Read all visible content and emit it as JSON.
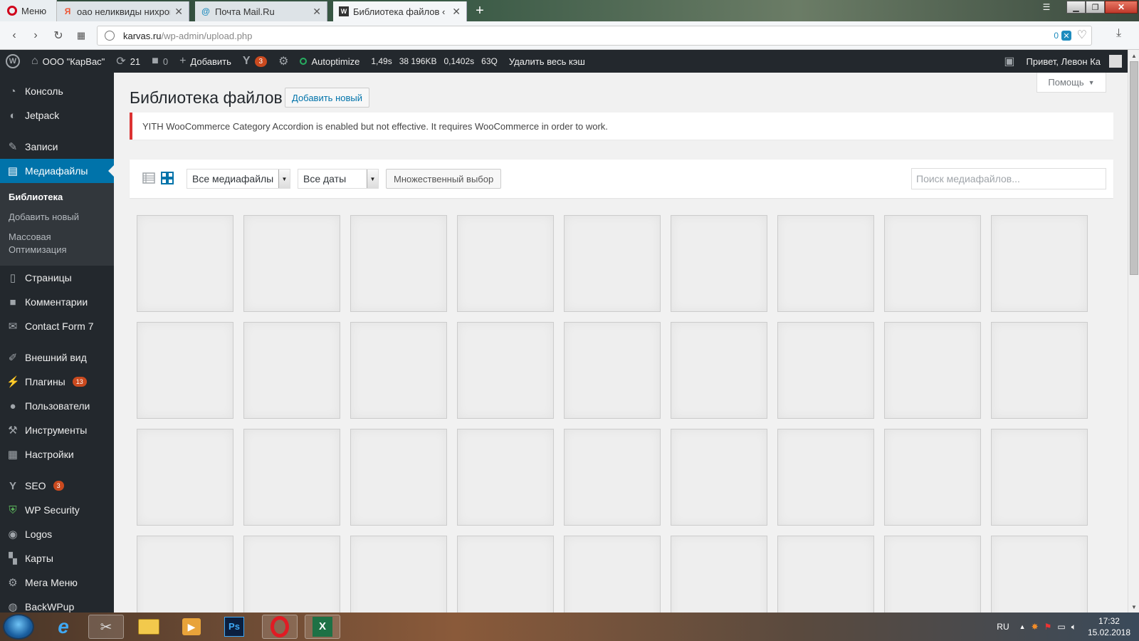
{
  "browser": {
    "menu_label": "Меню",
    "tabs": [
      {
        "title": "оао неликвиды нихром –",
        "favicon": "yandex-icon"
      },
      {
        "title": "Почта Mail.Ru",
        "favicon": "mailru-icon"
      },
      {
        "title": "Библиотека файлов ‹ ООО",
        "favicon": "wordpress-icon"
      }
    ],
    "url_host": "karvas.ru",
    "url_path": "/wp-admin/upload.php",
    "adblock_count": "0"
  },
  "adminbar": {
    "site_name": "ООО \"КарВас\"",
    "updates_count": "21",
    "comments_count": "0",
    "add_label": "Добавить",
    "yoast_badge": "3",
    "autoptimize_label": "Autoptimize",
    "stats": [
      "1,49s",
      "38 196KB",
      "0,1402s",
      "63Q"
    ],
    "clear_cache_label": "Удалить весь кэш",
    "greeting": "Привет, Левон Ка"
  },
  "sidebar": {
    "items": [
      {
        "label": "Консоль",
        "icon": "dashboard-icon"
      },
      {
        "label": "Jetpack",
        "icon": "jetpack-icon"
      },
      {
        "label": "Записи",
        "icon": "pin-icon"
      },
      {
        "label": "Медиафайлы",
        "icon": "media-icon"
      },
      {
        "label": "Страницы",
        "icon": "page-icon"
      },
      {
        "label": "Комментарии",
        "icon": "comment-icon"
      },
      {
        "label": "Contact Form 7",
        "icon": "mail-icon"
      },
      {
        "label": "Внешний вид",
        "icon": "brush-icon"
      },
      {
        "label": "Плагины",
        "icon": "plugin-icon",
        "badge": "13"
      },
      {
        "label": "Пользователи",
        "icon": "user-icon"
      },
      {
        "label": "Инструменты",
        "icon": "wrench-icon"
      },
      {
        "label": "Настройки",
        "icon": "settings-icon"
      },
      {
        "label": "SEO",
        "icon": "yoast-icon",
        "badge": "3"
      },
      {
        "label": "WP Security",
        "icon": "shield-icon"
      },
      {
        "label": "Logos",
        "icon": "logos-icon"
      },
      {
        "label": "Карты",
        "icon": "map-icon"
      },
      {
        "label": "Мега Меню",
        "icon": "megamenu-icon"
      },
      {
        "label": "BackWPup",
        "icon": "backup-icon"
      }
    ],
    "submenu": [
      {
        "label": "Библиотека",
        "current": true
      },
      {
        "label": "Добавить новый"
      },
      {
        "label": "Массовая Оптимизация"
      }
    ]
  },
  "main": {
    "help_label": "Помощь",
    "title": "Библиотека файлов",
    "add_new_label": "Добавить новый",
    "notice_text": "YITH WooCommerce Category Accordion is enabled but not effective. It requires WooCommerce in order to work.",
    "filter_type": "Все медиафайлы",
    "filter_date": "Все даты",
    "bulk_select_label": "Множественный выбор",
    "search_placeholder": "Поиск медиафайлов..."
  },
  "taskbar": {
    "language": "RU",
    "time": "17:32",
    "date": "15.02.2018"
  },
  "colors": {
    "admin_dark": "#23282d",
    "accent": "#0073aa",
    "badge": "#ca4a1f",
    "notice_error": "#dc3232"
  }
}
